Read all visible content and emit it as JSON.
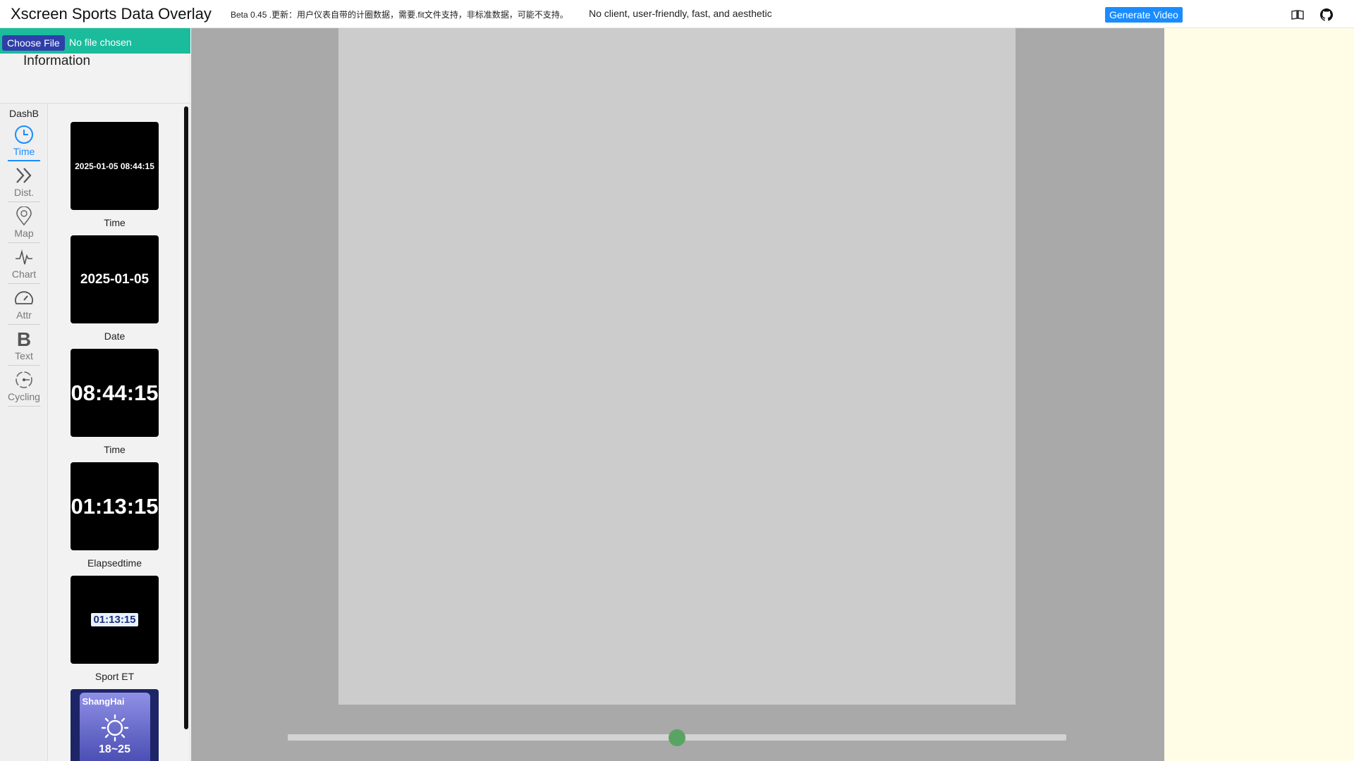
{
  "header": {
    "title": "Xscreen Sports Data Overlay",
    "version_note": "Beta 0.45 .更新：用户仪表自带的计圈数据，需要.fit文件支持，非标准数据，可能不支持。",
    "tagline": "No client, user-friendly, fast, and aesthetic",
    "generate_label": "Generate Video",
    "icons": [
      "book-icon",
      "github-icon"
    ]
  },
  "file": {
    "choose_label": "Choose File",
    "status": "No file chosen"
  },
  "info": {
    "title": "Information"
  },
  "nav": {
    "heading": "DashB",
    "items": [
      {
        "label": "Time",
        "icon": "clock-icon",
        "active": true
      },
      {
        "label": "Dist.",
        "icon": "double-chevron-icon",
        "active": false
      },
      {
        "label": "Map",
        "icon": "map-pin-icon",
        "active": false
      },
      {
        "label": "Chart",
        "icon": "pulse-icon",
        "active": false
      },
      {
        "label": "Attr",
        "icon": "gauge-icon",
        "active": false
      },
      {
        "label": "Text",
        "icon": "bold-icon",
        "active": false
      },
      {
        "label": "Cycling",
        "icon": "cycling-icon",
        "active": false
      }
    ]
  },
  "widgets": [
    {
      "preview": "2025-01-05 08:44:15",
      "caption": "Time"
    },
    {
      "preview": "2025-01-05",
      "caption": "Date"
    },
    {
      "preview": "08:44:15",
      "caption": "Time"
    },
    {
      "preview": "01:13:15",
      "caption": "Elapsedtime"
    },
    {
      "preview": "01:13:15",
      "caption": "Sport ET"
    },
    {
      "preview_city": "ShangHai",
      "preview_temp": "18~25",
      "caption": ""
    }
  ],
  "timeline": {
    "position": 0.5
  },
  "colors": {
    "accent": "#1a8cff",
    "file_bar": "#1abc9c",
    "knob": "#5aa463"
  }
}
